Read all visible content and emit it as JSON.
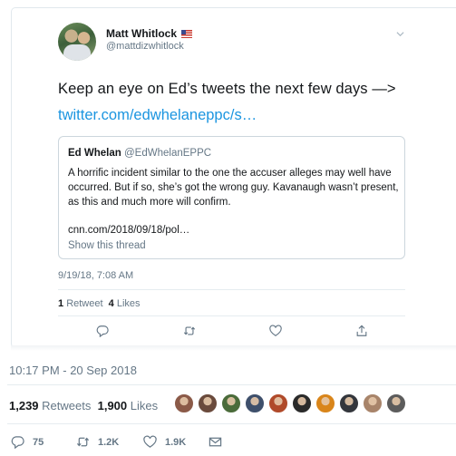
{
  "embedded_tweet": {
    "author_name": "Matt Whitlock",
    "author_handle": "@mattdizwhitlock",
    "text": "Keep an eye on Ed’s tweets the next few days —>",
    "link": "twitter.com/edwhelaneppc/s…",
    "quoted": {
      "author_name": "Ed Whelan",
      "author_handle": "@EdWhelanEPPC",
      "text": "A horrific incident similar to the one the accuser alleges may well have occurred. But if so, she’s got the wrong guy. Kavanaugh wasn’t present, as this and much more will confirm.",
      "link": "cnn.com/2018/09/18/pol…",
      "show_thread": "Show this thread"
    },
    "timestamp": "9/19/18, 7:08 AM",
    "retweets_count": "1",
    "retweets_label": "Retweet",
    "likes_count": "4",
    "likes_label": "Likes",
    "icons": [
      "reply-icon",
      "retweet-icon",
      "like-icon",
      "share-icon"
    ]
  },
  "tweet_meta": {
    "timestamp": "10:17 PM - 20 Sep 2018",
    "retweets_count": "1,239",
    "retweets_label": "Retweets",
    "likes_count": "1,900",
    "likes_label": "Likes"
  },
  "likers": [
    {
      "color": "#8b5a48"
    },
    {
      "color": "#6a4a3c"
    },
    {
      "color": "#4a6b3a"
    },
    {
      "color": "#3e4f6b"
    },
    {
      "color": "#b04a2a"
    },
    {
      "color": "#2a2a2a"
    },
    {
      "color": "#d9851a"
    },
    {
      "color": "#33363c"
    },
    {
      "color": "#a8846a"
    },
    {
      "color": "#5c5c5c"
    }
  ],
  "actions": {
    "replies": "75",
    "retweets": "1.2K",
    "likes": "1.9K"
  },
  "colors": {
    "link": "#1b95e0",
    "secondary": "#657786",
    "border": "#e1e8ed"
  }
}
